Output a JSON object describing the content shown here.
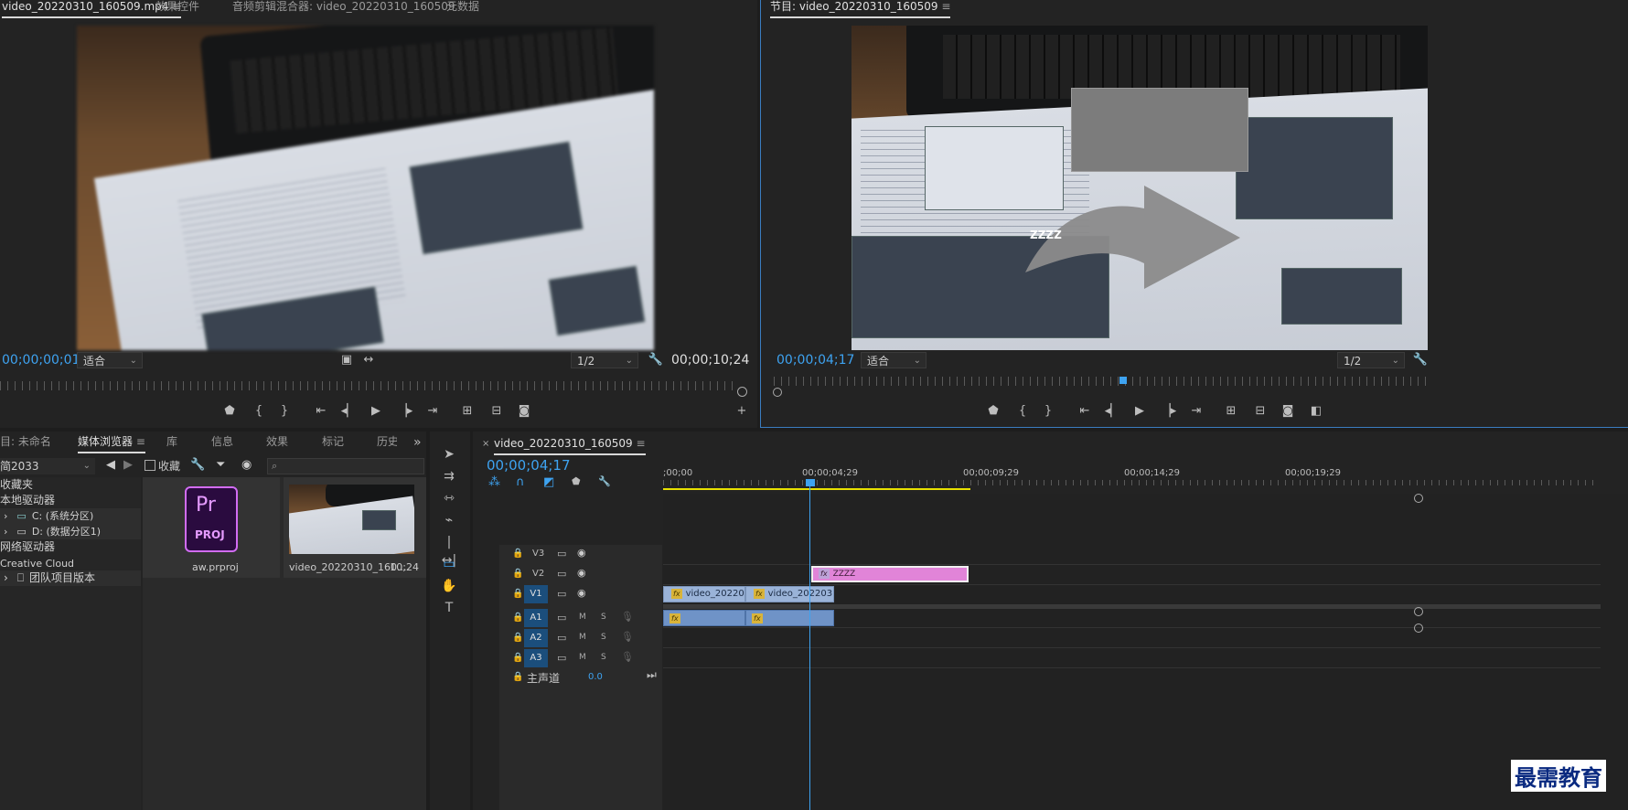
{
  "source_monitor": {
    "tabs": [
      {
        "label": "video_20220310_160509.mp4",
        "active": true
      },
      {
        "label": "效果控件"
      },
      {
        "label": "音频剪辑混合器: video_20220310_160509"
      },
      {
        "label": "元数据"
      }
    ],
    "timecode_in": "00;00;00;01",
    "fit": "适合",
    "resolution": "1/2",
    "duration": "00;00;10;24"
  },
  "program_monitor": {
    "title": "节目: video_20220310_160509",
    "timecode": "00;00;04;17",
    "fit": "适合",
    "resolution": "1/2",
    "title_overlay_text": "ZZZZ"
  },
  "project_panel": {
    "tabs": [
      "目: 未命名",
      "媒体浏览器",
      "库",
      "信息",
      "效果",
      "标记",
      "历史"
    ],
    "active_tab": "媒体浏览器",
    "path_select": "简2033",
    "favorites_label": "收藏",
    "search_placeholder": "",
    "tree": {
      "favorites": "收藏夹",
      "local": "本地驱动器",
      "drive_c": "C: (系统分区)",
      "drive_d": "D: (数据分区1)",
      "network": "网络驱动器",
      "cc": "Creative Cloud",
      "team": "团队项目版本"
    },
    "items": [
      {
        "name": "aw.prproj",
        "icon_text_top": "Pr",
        "icon_text_bottom": "PROJ"
      },
      {
        "name": "video_20220310_160...",
        "duration": "10;24"
      }
    ]
  },
  "timeline": {
    "sequence_name": "video_20220310_160509",
    "timecode": "00;00;04;17",
    "ruler_labels": [
      ";00;00",
      "00;00;04;29",
      "00;00;09;29",
      "00;00;14;29",
      "00;00;19;29"
    ],
    "video_tracks": [
      "V3",
      "V2",
      "V1"
    ],
    "audio_tracks": [
      "A1",
      "A2",
      "A3"
    ],
    "master_label": "主声道",
    "master_value": "0.0",
    "track_buttons": {
      "m": "M",
      "s": "S"
    },
    "clips": {
      "v2_title": "ZZZZ",
      "v1_clip1": "video_20220310",
      "v1_clip2": "video_20220310_1"
    }
  },
  "watermark": "最需教育",
  "colors": {
    "accent": "#3ea3f1",
    "playhead": "#3ea3f1",
    "title_clip": "#e184d8",
    "video_clip": "#9ab3d8",
    "audio_clip": "#6f93c7",
    "work_area": "#e8e000"
  }
}
